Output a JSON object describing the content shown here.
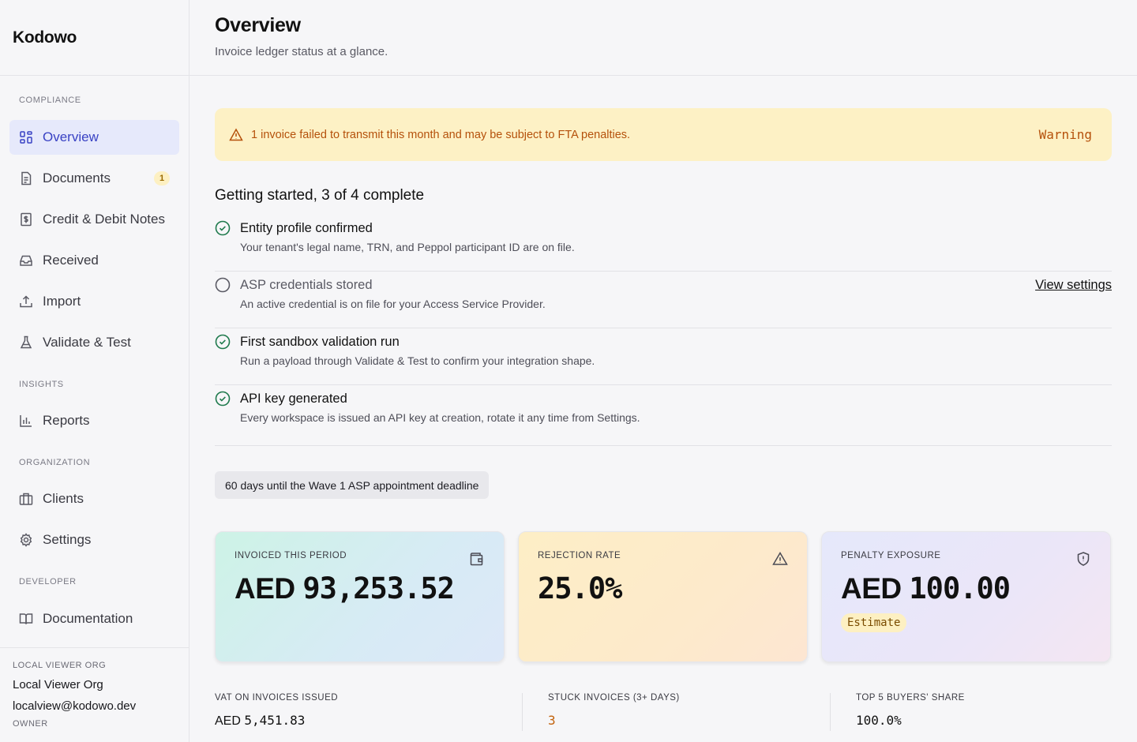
{
  "brand": "Kodowo",
  "nav": {
    "sections": {
      "compliance": "COMPLIANCE",
      "insights": "INSIGHTS",
      "organization": "ORGANIZATION",
      "developer": "DEVELOPER"
    },
    "items": [
      {
        "label": "Overview",
        "icon": "grid-icon",
        "active": true
      },
      {
        "label": "Documents",
        "icon": "document-icon",
        "badge": "1"
      },
      {
        "label": "Credit & Debit Notes",
        "icon": "receipt-icon"
      },
      {
        "label": "Received",
        "icon": "inbox-icon"
      },
      {
        "label": "Import",
        "icon": "upload-icon"
      },
      {
        "label": "Validate & Test",
        "icon": "flask-icon"
      },
      {
        "label": "Reports",
        "icon": "bar-chart-icon"
      },
      {
        "label": "Clients",
        "icon": "briefcase-icon"
      },
      {
        "label": "Settings",
        "icon": "gear-icon"
      },
      {
        "label": "Documentation",
        "icon": "book-icon"
      }
    ]
  },
  "org": {
    "label": "LOCAL VIEWER ORG",
    "name": "Local Viewer Org",
    "email": "localview@kodowo.dev",
    "role": "OWNER"
  },
  "header": {
    "title": "Overview",
    "subtitle": "Invoice ledger status at a glance."
  },
  "alert": {
    "text": "1 invoice failed to transmit this month and may be subject to FTA penalties.",
    "tag": "Warning"
  },
  "checklist": {
    "title": "Getting started, 3 of 4 complete",
    "items": [
      {
        "title": "Entity profile confirmed",
        "desc": "Your tenant's legal name, TRN, and Peppol participant ID are on file.",
        "done": true
      },
      {
        "title": "ASP credentials stored",
        "desc": "An active credential is on file for your Access Service Provider.",
        "done": false,
        "link": "View settings"
      },
      {
        "title": "First sandbox validation run",
        "desc": "Run a payload through Validate & Test to confirm your integration shape.",
        "done": true
      },
      {
        "title": "API key generated",
        "desc": "Every workspace is issued an API key at creation, rotate it any time from Settings.",
        "done": true
      }
    ]
  },
  "deadline": "60 days until the Wave 1 ASP appointment deadline",
  "cards": [
    {
      "label": "INVOICED THIS PERIOD",
      "prefix": "AED",
      "value": "93,253.52",
      "icon": "wallet-icon"
    },
    {
      "label": "REJECTION RATE",
      "prefix": "",
      "value": "25.0%",
      "icon": "warning-triangle-icon"
    },
    {
      "label": "PENALTY EXPOSURE",
      "prefix": "AED",
      "value": "100.00",
      "icon": "shield-icon",
      "badge": "Estimate"
    }
  ],
  "stats": [
    {
      "label": "VAT ON INVOICES ISSUED",
      "prefix": "AED",
      "value": "5,451.83"
    },
    {
      "label": "STUCK INVOICES (3+ DAYS)",
      "value": "3"
    },
    {
      "label": "TOP 5 BUYERS' SHARE",
      "value": "100.0%"
    }
  ],
  "colors": {
    "accent": "#3942c4",
    "warning": "#b5510b",
    "success": "#1f7a4d"
  }
}
